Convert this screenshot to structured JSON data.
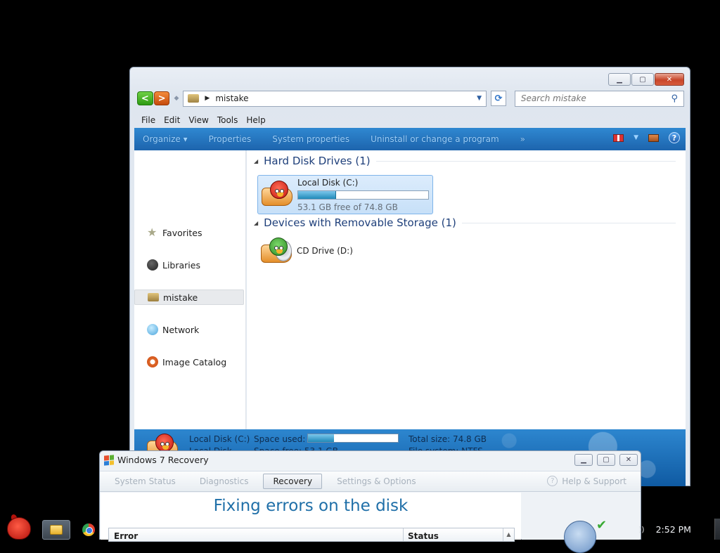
{
  "explorer": {
    "address_path": "mistake",
    "search_placeholder": "Search mistake",
    "menu": [
      "File",
      "Edit",
      "View",
      "Tools",
      "Help"
    ],
    "commands": [
      "Organize ▾",
      "Properties",
      "System properties",
      "Uninstall or change a program",
      "»"
    ],
    "nav": [
      "Favorites",
      "Libraries",
      "mistake",
      "Network",
      "Image Catalog"
    ],
    "groups": {
      "hdd_title": "Hard Disk Drives (1)",
      "removable_title": "Devices with Removable Storage (1)"
    },
    "drive_c": {
      "name": "Local Disk (C:)",
      "free": "53.1 GB free of 74.8 GB",
      "used_fraction": 0.29
    },
    "drive_d": {
      "name": "CD Drive (D:)"
    },
    "details": {
      "name": "Local Disk (C:)",
      "space_used_label": "Space used:",
      "total_size": "Total size: 74.8 GB",
      "line2_left": "Local Disk",
      "line2_mid": "Space free: 53.1 GB",
      "line2_right": "File system: NTFS"
    }
  },
  "recovery": {
    "title": "Windows 7 Recovery",
    "tabs": [
      "System Status",
      "Diagnostics",
      "Recovery",
      "Settings & Options"
    ],
    "active_tab": "Recovery",
    "help": "Help & Support",
    "heading": "Fixing errors on the disk",
    "table_headers": [
      "Error",
      "Status"
    ]
  },
  "taskbar": {
    "clock": "2:52 PM"
  },
  "colors": {
    "accent": "#1f6fa8",
    "cmdbar": "#1d64ad"
  }
}
